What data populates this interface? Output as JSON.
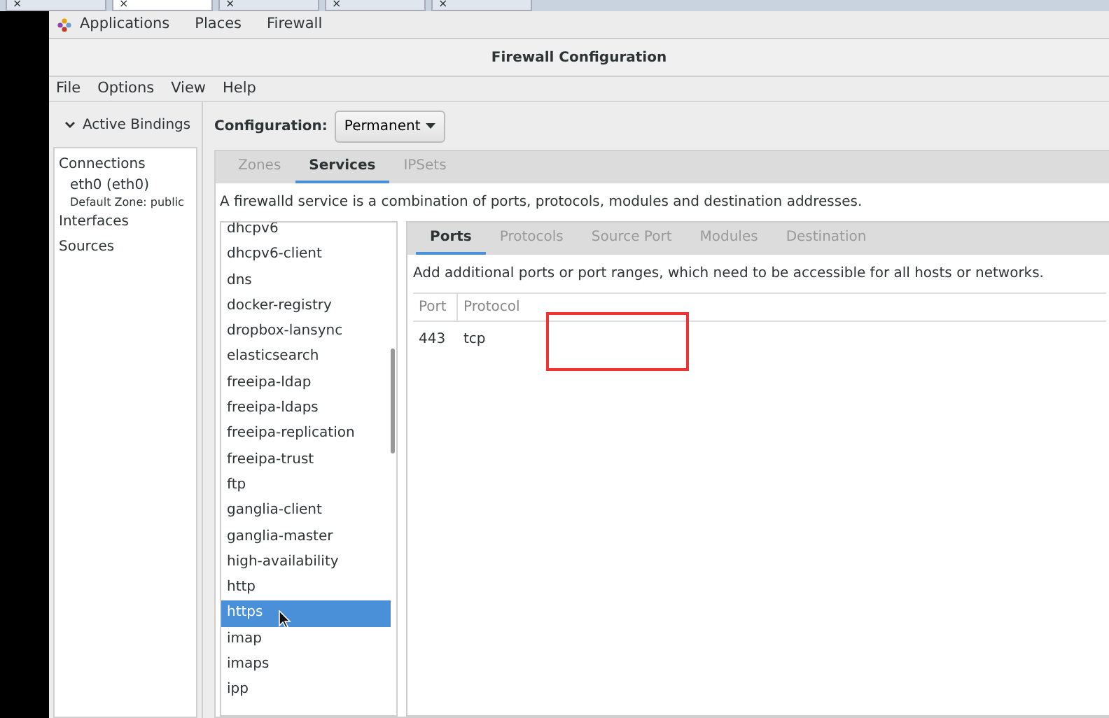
{
  "browser_tabs": [
    {
      "close": "×",
      "selected": false
    },
    {
      "close": "×",
      "selected": true
    },
    {
      "close": "×",
      "selected": false
    },
    {
      "close": "×",
      "selected": false
    },
    {
      "close": "×",
      "selected": false
    }
  ],
  "top_bar": {
    "items": [
      "Applications",
      "Places",
      "Firewall"
    ]
  },
  "window": {
    "title": "Firewall Configuration"
  },
  "menu": [
    "File",
    "Options",
    "View",
    "Help"
  ],
  "sidebar": {
    "header": "Active Bindings",
    "expanded": true,
    "items": [
      {
        "kind": "heading",
        "label": "Connections"
      },
      {
        "kind": "connection",
        "label": "eth0 (eth0)",
        "detail": "Default Zone: public"
      },
      {
        "kind": "heading",
        "label": "Interfaces"
      },
      {
        "kind": "heading",
        "label": "Sources"
      }
    ]
  },
  "configuration": {
    "label": "Configuration:",
    "value": "Permanent"
  },
  "tabs": [
    {
      "label": "Zones",
      "selected": false
    },
    {
      "label": "Services",
      "selected": true
    },
    {
      "label": "IPSets",
      "selected": false
    }
  ],
  "services_description": "A firewalld service is a combination of ports, protocols, modules and destination addresses.",
  "services": [
    {
      "name": "dhcpv6",
      "selected": false
    },
    {
      "name": "dhcpv6-client",
      "selected": false
    },
    {
      "name": "dns",
      "selected": false
    },
    {
      "name": "docker-registry",
      "selected": false
    },
    {
      "name": "dropbox-lansync",
      "selected": false
    },
    {
      "name": "elasticsearch",
      "selected": false
    },
    {
      "name": "freeipa-ldap",
      "selected": false
    },
    {
      "name": "freeipa-ldaps",
      "selected": false
    },
    {
      "name": "freeipa-replication",
      "selected": false
    },
    {
      "name": "freeipa-trust",
      "selected": false
    },
    {
      "name": "ftp",
      "selected": false
    },
    {
      "name": "ganglia-client",
      "selected": false
    },
    {
      "name": "ganglia-master",
      "selected": false
    },
    {
      "name": "high-availability",
      "selected": false
    },
    {
      "name": "http",
      "selected": false
    },
    {
      "name": "https",
      "selected": true
    },
    {
      "name": "imap",
      "selected": false
    },
    {
      "name": "imaps",
      "selected": false
    },
    {
      "name": "ipp",
      "selected": false
    }
  ],
  "service_tabs": [
    {
      "label": "Ports",
      "selected": true
    },
    {
      "label": "Protocols",
      "selected": false
    },
    {
      "label": "Source Port",
      "selected": false
    },
    {
      "label": "Modules",
      "selected": false
    },
    {
      "label": "Destination",
      "selected": false
    }
  ],
  "ports_description": "Add additional ports or port ranges, which need to be accessible for all hosts or networks.",
  "table": {
    "columns": [
      "Port",
      "Protocol"
    ],
    "rows": [
      [
        "443",
        "tcp"
      ]
    ]
  },
  "annotation": {
    "color": "#ee3333"
  }
}
